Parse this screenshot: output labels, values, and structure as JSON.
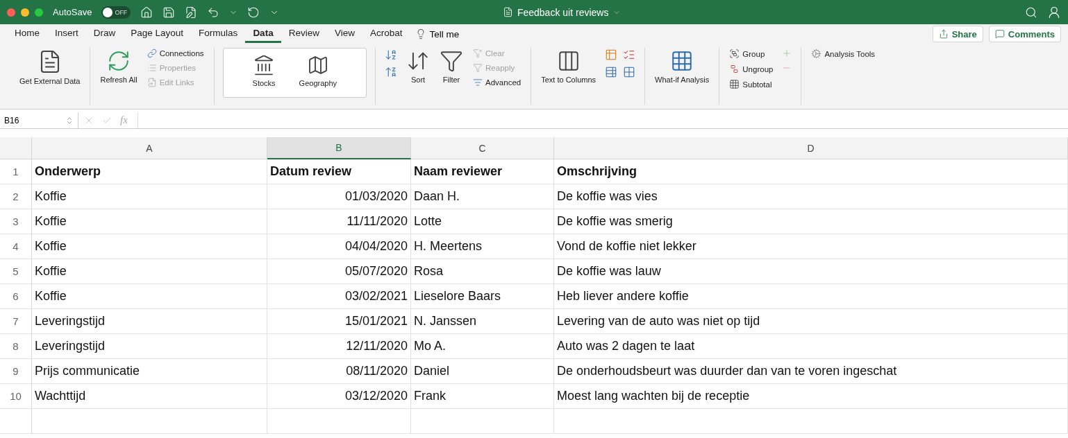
{
  "title_bar": {
    "autosave_label": "AutoSave",
    "autosave_toggle": {
      "on": false,
      "label": "OFF"
    },
    "document_title": "Feedback uit reviews"
  },
  "menu_tabs": [
    {
      "label": "Home",
      "selected": false
    },
    {
      "label": "Insert",
      "selected": false
    },
    {
      "label": "Draw",
      "selected": false
    },
    {
      "label": "Page Layout",
      "selected": false
    },
    {
      "label": "Formulas",
      "selected": false
    },
    {
      "label": "Data",
      "selected": true
    },
    {
      "label": "Review",
      "selected": false
    },
    {
      "label": "View",
      "selected": false
    },
    {
      "label": "Acrobat",
      "selected": false
    }
  ],
  "tell_me": "Tell me",
  "share": "Share",
  "comments": "Comments",
  "ribbon": [
    {
      "kind": "external",
      "buttons": [
        {
          "label": "Get External Data",
          "disabled": false
        }
      ]
    },
    {
      "kind": "queries",
      "buttons": [
        {
          "label": "Refresh All",
          "disabled": false
        },
        {
          "label": "Connections",
          "disabled": false
        },
        {
          "label": "Properties",
          "disabled": true
        },
        {
          "label": "Edit Links",
          "disabled": true
        }
      ]
    },
    {
      "kind": "data_types",
      "buttons": [
        {
          "label": "Stocks",
          "disabled": false
        },
        {
          "label": "Geography",
          "disabled": false
        }
      ]
    },
    {
      "kind": "sort_filter",
      "buttons": [
        {
          "label": "Sort",
          "disabled": false
        },
        {
          "label": "Filter",
          "disabled": false
        },
        {
          "label": "Clear",
          "disabled": true
        },
        {
          "label": "Reapply",
          "disabled": true
        },
        {
          "label": "Advanced",
          "disabled": false
        }
      ]
    },
    {
      "kind": "tools",
      "buttons": [
        {
          "label": "Text to Columns",
          "disabled": false
        }
      ]
    },
    {
      "kind": "forecast",
      "buttons": [
        {
          "label": "What-if Analysis",
          "disabled": false
        }
      ]
    },
    {
      "kind": "outline",
      "buttons": [
        {
          "label": "Group",
          "disabled": false
        },
        {
          "label": "Ungroup",
          "disabled": false
        },
        {
          "label": "Subtotal",
          "disabled": false
        }
      ]
    },
    {
      "kind": "analysis",
      "buttons": [
        {
          "label": "Analysis Tools",
          "disabled": false
        }
      ]
    }
  ],
  "formula_bar": {
    "name_box": "B16",
    "fx": "fx"
  },
  "sheet": {
    "columns": [
      {
        "label": "A",
        "selected": false
      },
      {
        "label": "B",
        "selected": true
      },
      {
        "label": "C",
        "selected": false
      },
      {
        "label": "D",
        "selected": false
      }
    ],
    "rows": [
      {
        "number": "1",
        "kind": "header",
        "cells": [
          "Onderwerp",
          "Datum review",
          "Naam reviewer",
          "Omschrijving"
        ]
      },
      {
        "number": "2",
        "kind": "data",
        "cells": [
          "Koffie",
          "01/03/2020",
          "Daan H.",
          "De koffie was vies"
        ]
      },
      {
        "number": "3",
        "kind": "data",
        "cells": [
          "Koffie",
          "11/11/2020",
          "Lotte",
          "De koffie was smerig"
        ]
      },
      {
        "number": "4",
        "kind": "data",
        "cells": [
          "Koffie",
          "04/04/2020",
          "H. Meertens",
          "Vond de koffie niet lekker"
        ]
      },
      {
        "number": "5",
        "kind": "data",
        "cells": [
          "Koffie",
          "05/07/2020",
          "Rosa",
          "De koffie was lauw"
        ]
      },
      {
        "number": "6",
        "kind": "data",
        "cells": [
          "Koffie",
          "03/02/2021",
          "Lieselore Baars",
          "Heb liever andere koffie"
        ]
      },
      {
        "number": "7",
        "kind": "data",
        "cells": [
          "Leveringstijd",
          "15/01/2021",
          "N. Janssen",
          "Levering van de auto was niet op tijd"
        ]
      },
      {
        "number": "8",
        "kind": "data",
        "cells": [
          "Leveringstijd",
          "12/11/2020",
          "Mo A.",
          "Auto was 2 dagen te laat"
        ]
      },
      {
        "number": "9",
        "kind": "data",
        "cells": [
          "Prijs communicatie",
          "08/11/2020",
          "Daniel",
          "De onderhoudsbeurt was duurder dan van te voren ingeschat"
        ]
      },
      {
        "number": "10",
        "kind": "data",
        "cells": [
          "Wachttijd",
          "03/12/2020",
          "Frank",
          "Moest lang wachten bij de receptie"
        ]
      }
    ]
  }
}
